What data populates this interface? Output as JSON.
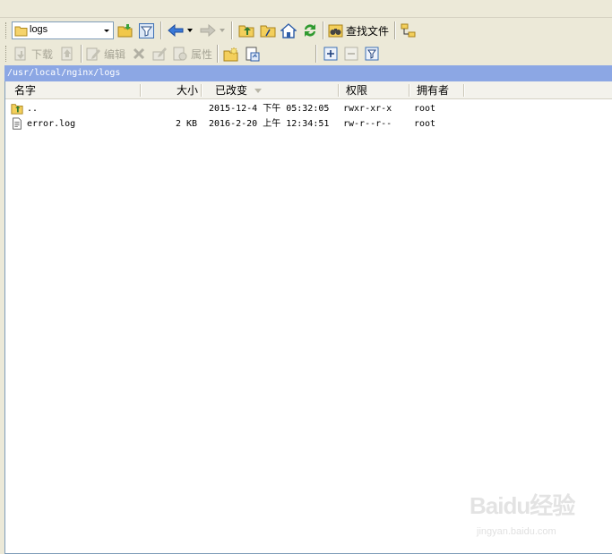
{
  "toolbar": {
    "location_combo_value": "logs",
    "search_files_label": "查找文件"
  },
  "action_bar": {
    "download_label": "下载",
    "edit_label": "编辑",
    "properties_label": "属性"
  },
  "path": "/usr/local/nginx/logs",
  "columns": {
    "name": "名字",
    "size": "大小",
    "modified": "已改变",
    "permissions": "权限",
    "owner": "拥有者"
  },
  "files": [
    {
      "name": "..",
      "size": "",
      "modified": "2015-12-4 下午 05:32:05",
      "permissions": "rwxr-xr-x",
      "owner": "root",
      "icon": "parent-folder-icon"
    },
    {
      "name": "error.log",
      "size": "2 KB",
      "modified": "2016-2-20 上午 12:34:51",
      "permissions": "rw-r--r--",
      "owner": "root",
      "icon": "text-file-icon"
    }
  ],
  "watermark": {
    "brand": "Baidu经验",
    "url": "jingyan.baidu.com"
  },
  "colors": {
    "path_bar": "#8ca7e4",
    "toolbar_bg": "#ece9d8",
    "list_bg": "#ffffff"
  }
}
